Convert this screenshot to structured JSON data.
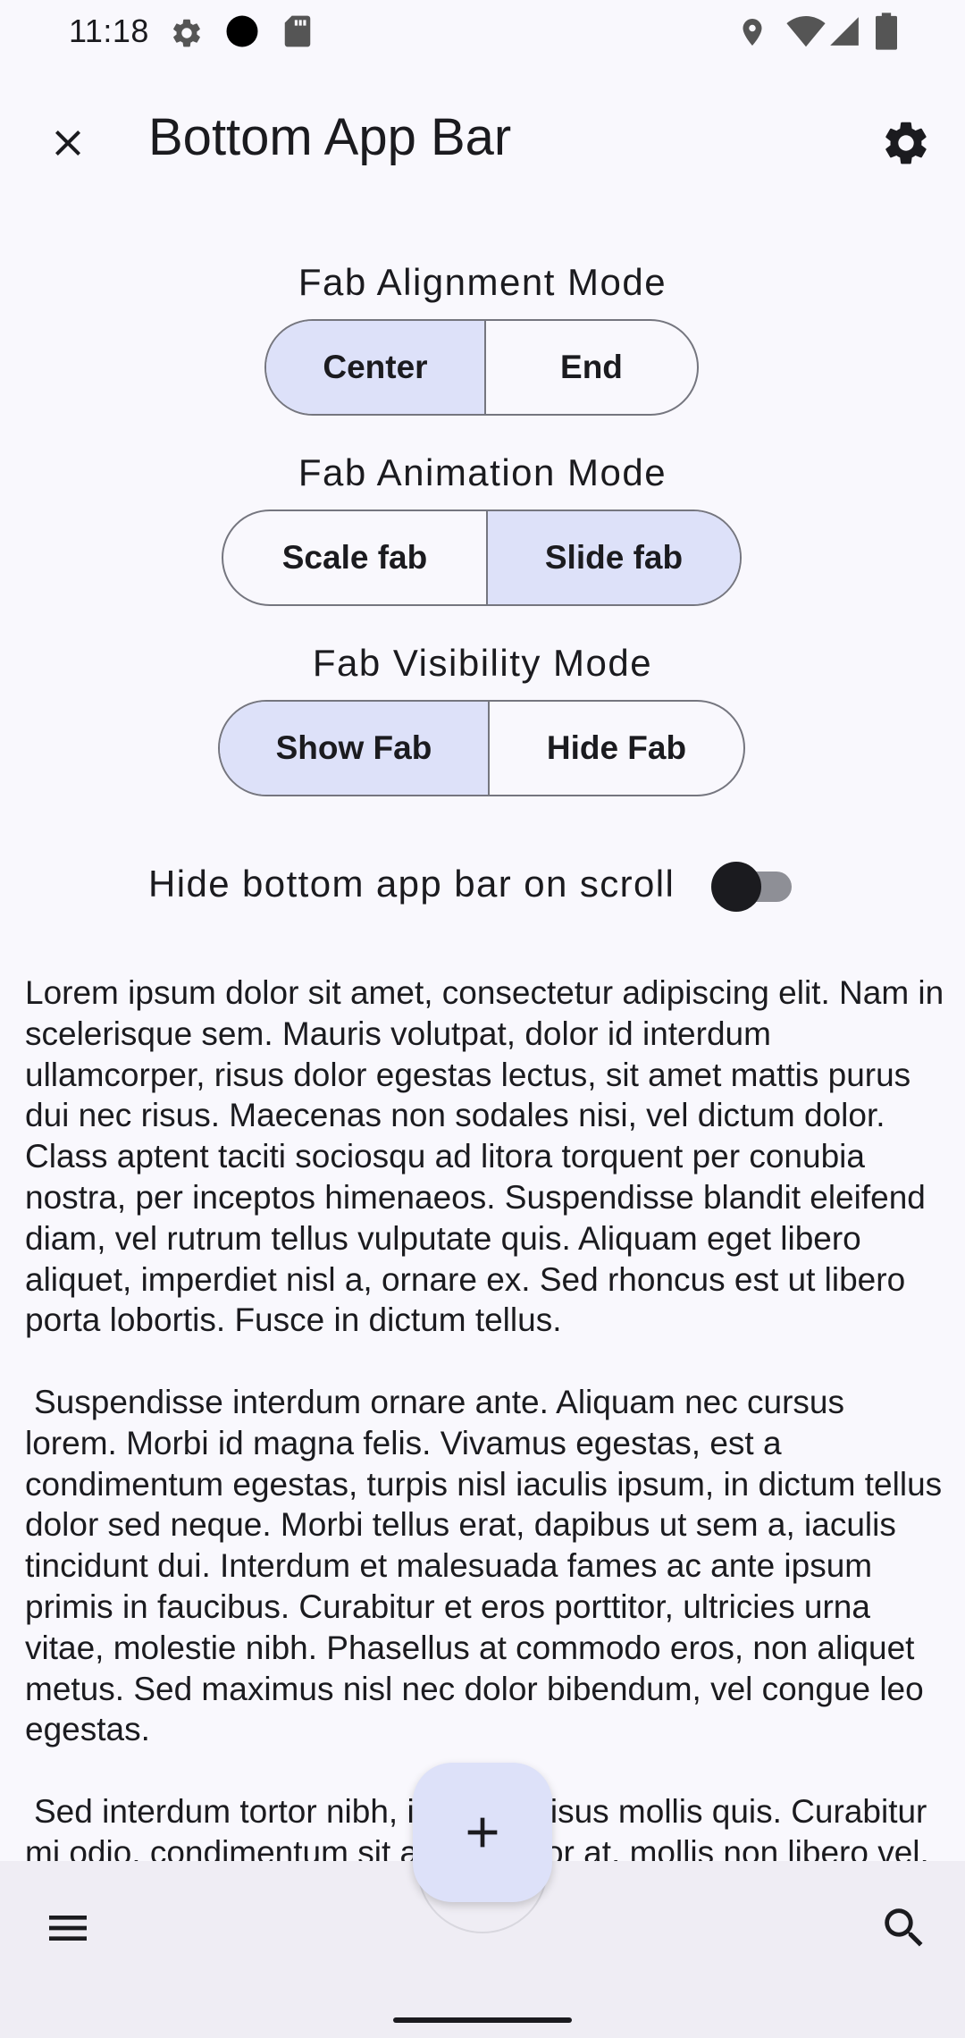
{
  "status": {
    "time": "11:18",
    "icons": [
      "gear-icon",
      "circle-icon",
      "sd-card-icon",
      "location-icon",
      "wifi-icon",
      "signal-icon",
      "battery-icon"
    ]
  },
  "toolbar": {
    "title": "Bottom App Bar",
    "close_icon": "close-icon",
    "settings_icon": "gear-icon"
  },
  "fab_alignment": {
    "label": "Fab Alignment Mode",
    "options": [
      "Center",
      "End"
    ],
    "selected": "Center"
  },
  "fab_animation": {
    "label": "Fab Animation Mode",
    "options": [
      "Scale fab",
      "Slide fab"
    ],
    "selected": "Slide fab"
  },
  "fab_visibility": {
    "label": "Fab Visibility Mode",
    "options": [
      "Show Fab",
      "Hide Fab"
    ],
    "selected": "Show Fab"
  },
  "hide_on_scroll": {
    "label": "Hide bottom app bar on scroll",
    "checked": false
  },
  "content": {
    "paragraphs": [
      "Lorem ipsum dolor sit amet, consectetur adipiscing elit. Nam in scelerisque sem. Mauris volutpat, dolor id interdum ullamcorper, risus dolor egestas lectus, sit amet mattis purus dui nec risus. Maecenas non sodales nisi, vel dictum dolor. Class aptent taciti sociosqu ad litora torquent per conubia nostra, per inceptos himenaeos. Suspendisse blandit eleifend diam, vel rutrum tellus vulputate quis. Aliquam eget libero aliquet, imperdiet nisl a, ornare ex. Sed rhoncus est ut libero porta lobortis. Fusce in dictum tellus.",
      "Suspendisse interdum ornare ante. Aliquam nec cursus lorem. Morbi id magna felis. Vivamus egestas, est a condimentum egestas, turpis nisl iaculis ipsum, in dictum tellus dolor sed neque. Morbi tellus erat, dapibus ut sem a, iaculis tincidunt dui. Interdum et malesuada fames ac ante ipsum primis in faucibus. Curabitur et eros porttitor, ultricies urna vitae, molestie nibh. Phasellus at commodo eros, non aliquet metus. Sed maximus nisl nec dolor bibendum, vel congue leo egestas.",
      "Sed interdum tortor nibh, in mattis risus mollis quis. Curabitur mi odio, condimentum sit amet auctor at, mollis non libero vel."
    ]
  },
  "bottom_bar": {
    "menu_icon": "menu-icon",
    "search_icon": "search-icon",
    "fab_icon": "add-icon"
  },
  "colors": {
    "background": "#f9f8fd",
    "selected_segment": "#dde1f9",
    "bottom_bar": "#efedf4",
    "fab": "#dde1f9"
  }
}
